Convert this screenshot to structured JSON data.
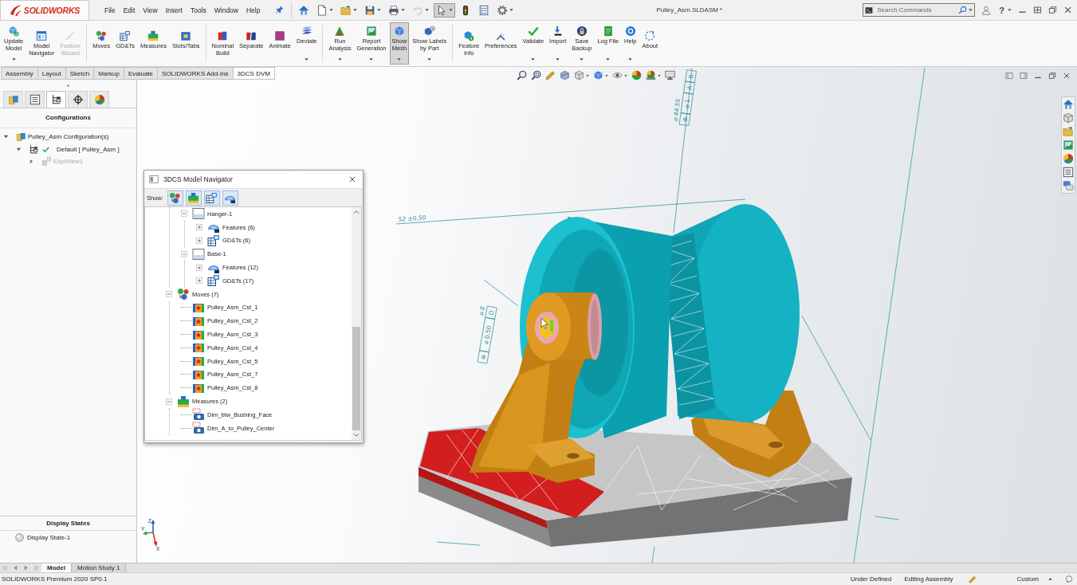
{
  "title_bar": {
    "logo": "SOLIDWORKS",
    "menu": [
      "File",
      "Edit",
      "View",
      "Insert",
      "Tools",
      "Window",
      "Help"
    ],
    "quick_access": [
      {
        "dropdown": false,
        "selected": false,
        "disabled": false
      },
      {
        "dropdown": true,
        "selected": false,
        "disabled": false
      },
      {
        "dropdown": true,
        "selected": false,
        "disabled": false
      },
      {
        "dropdown": true,
        "selected": false,
        "disabled": false
      },
      {
        "dropdown": true,
        "selected": false,
        "disabled": false
      },
      {
        "dropdown": true,
        "selected": false,
        "disabled": true
      },
      {
        "dropdown": true,
        "selected": true,
        "disabled": false
      },
      {
        "dropdown": false,
        "selected": false,
        "disabled": false
      },
      {
        "dropdown": false,
        "selected": false,
        "disabled": false
      },
      {
        "dropdown": true,
        "selected": false,
        "disabled": false
      }
    ],
    "document_title": "Pulley_Asm.SLDASM *",
    "search": {
      "placeholder": "Search Commands"
    },
    "help_glyph": "?"
  },
  "ribbon": {
    "groups": [
      [
        {
          "label": "Update\nModel",
          "dropdown": true,
          "disabled": false,
          "selected": false
        },
        {
          "label": "Model\nNavigator",
          "dropdown": false,
          "disabled": false,
          "selected": false
        },
        {
          "label": "Feature\nWizard",
          "dropdown": false,
          "disabled": true,
          "selected": false
        }
      ],
      [
        {
          "label": "Moves",
          "dropdown": false,
          "disabled": false,
          "selected": false
        },
        {
          "label": "GD&Ts",
          "dropdown": false,
          "disabled": false,
          "selected": false
        },
        {
          "label": "Measures",
          "dropdown": false,
          "disabled": false,
          "selected": false
        },
        {
          "label": "Slots/Tabs",
          "dropdown": false,
          "disabled": false,
          "selected": false
        }
      ],
      [
        {
          "label": "Nominal\nBuild",
          "dropdown": false,
          "disabled": false,
          "selected": false
        },
        {
          "label": "Separate",
          "dropdown": false,
          "disabled": false,
          "selected": false
        },
        {
          "label": "Animate",
          "dropdown": false,
          "disabled": false,
          "selected": false
        },
        {
          "label": "Deviate",
          "dropdown": true,
          "disabled": false,
          "selected": false
        }
      ],
      [
        {
          "label": "Run\nAnalysis",
          "dropdown": true,
          "disabled": false,
          "selected": false
        },
        {
          "label": "Report\nGeneration",
          "dropdown": true,
          "disabled": false,
          "selected": false
        },
        {
          "label": "Show\nMesh",
          "dropdown": true,
          "disabled": false,
          "selected": true
        },
        {
          "label": "Show Labels\nby Part",
          "dropdown": true,
          "disabled": false,
          "selected": false
        }
      ],
      [
        {
          "label": "Feature\nInfo",
          "dropdown": false,
          "disabled": false,
          "selected": false
        },
        {
          "label": "Preferences",
          "dropdown": false,
          "disabled": false,
          "selected": false
        },
        {
          "label": "Validate",
          "dropdown": true,
          "disabled": false,
          "selected": false
        },
        {
          "label": "Import",
          "dropdown": true,
          "disabled": false,
          "selected": false
        },
        {
          "label": "Save\nBackup",
          "dropdown": true,
          "disabled": false,
          "selected": false
        },
        {
          "label": "Log File",
          "dropdown": true,
          "disabled": false,
          "selected": false
        },
        {
          "label": "Help",
          "dropdown": true,
          "disabled": false,
          "selected": false
        },
        {
          "label": "About",
          "dropdown": false,
          "disabled": false,
          "selected": false
        }
      ]
    ]
  },
  "command_tabs": [
    {
      "label": "Assembly",
      "selected": false
    },
    {
      "label": "Layout",
      "selected": false
    },
    {
      "label": "Sketch",
      "selected": false
    },
    {
      "label": "Markup",
      "selected": false
    },
    {
      "label": "Evaluate",
      "selected": false
    },
    {
      "label": "SOLIDWORKS Add-Ins",
      "selected": false
    },
    {
      "label": "3DCS DVM",
      "selected": true
    }
  ],
  "left_panel": {
    "tabs": [
      {
        "selected": false
      },
      {
        "selected": false
      },
      {
        "selected": true
      },
      {
        "selected": false
      },
      {
        "selected": false
      }
    ],
    "heading": "Configurations",
    "tree": [
      {
        "label": "Pulley_Asm Configuration(s)",
        "kind": "assembly",
        "expanded": true,
        "active": false,
        "disabled": false,
        "children": [
          {
            "label": "Default [ Pulley_Asm ]",
            "kind": "configuration",
            "expanded": true,
            "active": true,
            "disabled": false,
            "children": [
              {
                "label": "ExplView1",
                "kind": "exploded_view",
                "expanded": false,
                "active": false,
                "disabled": true
              }
            ]
          }
        ]
      }
    ],
    "display_states": {
      "heading": "Display States",
      "items": [
        {
          "label": "Display State-1"
        }
      ]
    }
  },
  "viewport": {
    "view_toolbar": [
      {
        "dropdown": false
      },
      {
        "dropdown": false
      },
      {
        "dropdown": false
      },
      {
        "dropdown": false
      },
      {
        "dropdown": true
      },
      {
        "dropdown": true
      },
      {
        "dropdown": true
      },
      {
        "dropdown": false
      },
      {
        "dropdown": true
      },
      {
        "dropdown": false
      }
    ],
    "annotations": [
      {
        "kind": "linear",
        "text": "52 ±0.50"
      },
      {
        "kind": "diameter",
        "text": "⌀ 44.55",
        "frame": [
          "⊕",
          "⌀ 1",
          "A",
          "B"
        ]
      },
      {
        "kind": "diameter",
        "text": "⌀ 8",
        "frame": [
          "⊕",
          "⌀ 0.50",
          "D"
        ]
      }
    ],
    "triad_labels": [
      "Z",
      "Y",
      "X"
    ]
  },
  "model_navigator": {
    "title": "3DCS Model Navigator",
    "show_label": "Show:",
    "filters": [
      {
        "selected": true
      },
      {
        "selected": true
      },
      {
        "selected": true
      },
      {
        "selected": true
      }
    ],
    "tree": [
      {
        "children": [
          {
            "label": "Hanger-1",
            "kind": "part",
            "expanded": true,
            "children": [
              {
                "label": "Features (6)",
                "kind": "features",
                "expanded": false
              },
              {
                "label": "GD&Ts (6)",
                "kind": "gdts",
                "expanded": false
              }
            ]
          },
          {
            "label": "Base-1",
            "kind": "part",
            "expanded": true,
            "children": [
              {
                "label": "Features (12)",
                "kind": "features",
                "expanded": false
              },
              {
                "label": "GD&Ts (17)",
                "kind": "gdts",
                "expanded": false
              }
            ]
          }
        ]
      },
      {
        "label": "Moves (7)",
        "kind": "moves",
        "expanded": true,
        "children": [
          {
            "label": "Pulley_Asm_Cst_1",
            "kind": "move"
          },
          {
            "label": "Pulley_Asm_Cst_2",
            "kind": "move"
          },
          {
            "label": "Pulley_Asm_Cst_3",
            "kind": "move"
          },
          {
            "label": "Pulley_Asm_Cst_4",
            "kind": "move"
          },
          {
            "label": "Pulley_Asm_Cst_5",
            "kind": "move"
          },
          {
            "label": "Pulley_Asm_Cst_7",
            "kind": "move"
          },
          {
            "label": "Pulley_Asm_Cst_8",
            "kind": "move"
          }
        ]
      },
      {
        "label": "Measures (2)",
        "kind": "measures",
        "expanded": true,
        "children": [
          {
            "label": "Dim_btw_Bushing_Face",
            "kind": "measure"
          },
          {
            "label": "Dim_A_to_Pulley_Center",
            "kind": "measure"
          }
        ]
      }
    ]
  },
  "bottom_tabs": [
    {
      "label": "Model",
      "selected": true
    },
    {
      "label": "Motion Study 1",
      "selected": false
    }
  ],
  "status_bar": {
    "product": "SOLIDWORKS Premium 2020 SP0.1",
    "state": "Under Defined",
    "mode": "Editing Assembly",
    "units": "Custom"
  }
}
